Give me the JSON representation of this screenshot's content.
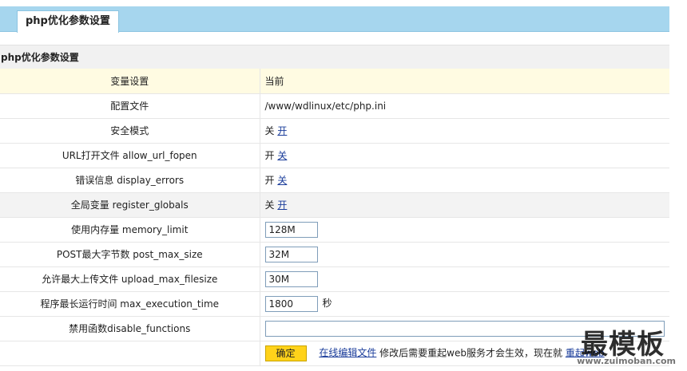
{
  "tab": {
    "label": "php优化参数设置"
  },
  "section": {
    "title": "php优化参数设置"
  },
  "header": {
    "col_setting": "变量设置",
    "col_current": "当前"
  },
  "rows": {
    "config_file": {
      "label": "配置文件",
      "value": "/www/wdlinux/etc/php.ini"
    },
    "safe_mode": {
      "label": "安全模式",
      "state": "关",
      "toggle": "开"
    },
    "allow_url_fopen": {
      "label": "URL打开文件 allow_url_fopen",
      "state": "开",
      "toggle": "关"
    },
    "display_errors": {
      "label": "错误信息 display_errors",
      "state": "开",
      "toggle": "关"
    },
    "register_globals": {
      "label": "全局变量 register_globals",
      "state": "关",
      "toggle": "开"
    },
    "memory_limit": {
      "label": "使用内存量 memory_limit",
      "value": "128M"
    },
    "post_max_size": {
      "label": "POST最大字节数 post_max_size",
      "value": "32M"
    },
    "upload_max_filesize": {
      "label": "允许最大上传文件 upload_max_filesize",
      "value": "30M"
    },
    "max_execution_time": {
      "label": "程序最长运行时间 max_execution_time",
      "value": "1800",
      "unit": "秒"
    },
    "disable_functions": {
      "label": "禁用函数disable_functions",
      "value": ""
    }
  },
  "footer": {
    "confirm_label": "确定",
    "edit_link": "在线编辑文件",
    "note": "修改后需要重起web服务才会生效，现在就",
    "restart_link": "重起web"
  },
  "watermark": {
    "big": "最模板",
    "small": "www.zuimoban.com"
  },
  "colors": {
    "tab_bar": "#a6d6ee",
    "header_row": "#fffbe2",
    "alt_row": "#f3f3f3",
    "link": "#1a3c9a",
    "confirm_button": "#ffd21a"
  }
}
